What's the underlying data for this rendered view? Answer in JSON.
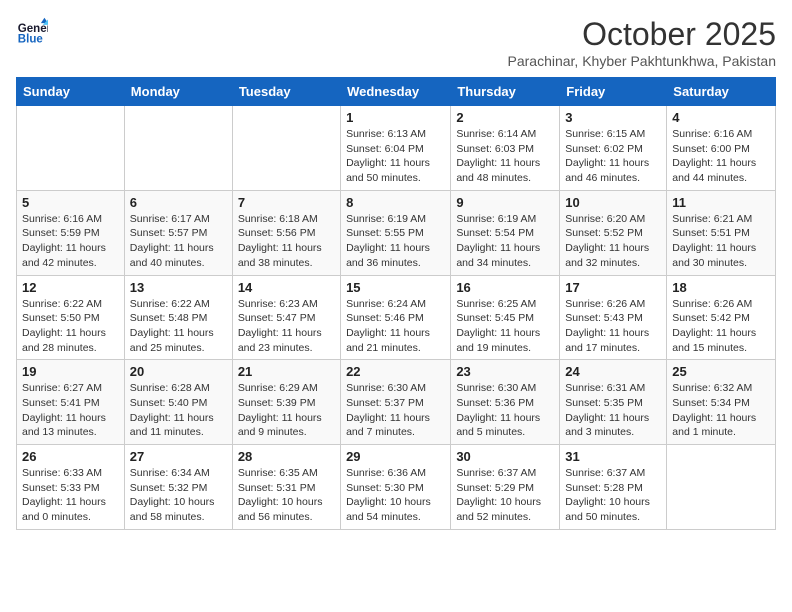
{
  "logo": {
    "line1": "General",
    "line2": "Blue"
  },
  "title": "October 2025",
  "location": "Parachinar, Khyber Pakhtunkhwa, Pakistan",
  "weekdays": [
    "Sunday",
    "Monday",
    "Tuesday",
    "Wednesday",
    "Thursday",
    "Friday",
    "Saturday"
  ],
  "weeks": [
    [
      {
        "day": "",
        "info": ""
      },
      {
        "day": "",
        "info": ""
      },
      {
        "day": "",
        "info": ""
      },
      {
        "day": "1",
        "info": "Sunrise: 6:13 AM\nSunset: 6:04 PM\nDaylight: 11 hours\nand 50 minutes."
      },
      {
        "day": "2",
        "info": "Sunrise: 6:14 AM\nSunset: 6:03 PM\nDaylight: 11 hours\nand 48 minutes."
      },
      {
        "day": "3",
        "info": "Sunrise: 6:15 AM\nSunset: 6:02 PM\nDaylight: 11 hours\nand 46 minutes."
      },
      {
        "day": "4",
        "info": "Sunrise: 6:16 AM\nSunset: 6:00 PM\nDaylight: 11 hours\nand 44 minutes."
      }
    ],
    [
      {
        "day": "5",
        "info": "Sunrise: 6:16 AM\nSunset: 5:59 PM\nDaylight: 11 hours\nand 42 minutes."
      },
      {
        "day": "6",
        "info": "Sunrise: 6:17 AM\nSunset: 5:57 PM\nDaylight: 11 hours\nand 40 minutes."
      },
      {
        "day": "7",
        "info": "Sunrise: 6:18 AM\nSunset: 5:56 PM\nDaylight: 11 hours\nand 38 minutes."
      },
      {
        "day": "8",
        "info": "Sunrise: 6:19 AM\nSunset: 5:55 PM\nDaylight: 11 hours\nand 36 minutes."
      },
      {
        "day": "9",
        "info": "Sunrise: 6:19 AM\nSunset: 5:54 PM\nDaylight: 11 hours\nand 34 minutes."
      },
      {
        "day": "10",
        "info": "Sunrise: 6:20 AM\nSunset: 5:52 PM\nDaylight: 11 hours\nand 32 minutes."
      },
      {
        "day": "11",
        "info": "Sunrise: 6:21 AM\nSunset: 5:51 PM\nDaylight: 11 hours\nand 30 minutes."
      }
    ],
    [
      {
        "day": "12",
        "info": "Sunrise: 6:22 AM\nSunset: 5:50 PM\nDaylight: 11 hours\nand 28 minutes."
      },
      {
        "day": "13",
        "info": "Sunrise: 6:22 AM\nSunset: 5:48 PM\nDaylight: 11 hours\nand 25 minutes."
      },
      {
        "day": "14",
        "info": "Sunrise: 6:23 AM\nSunset: 5:47 PM\nDaylight: 11 hours\nand 23 minutes."
      },
      {
        "day": "15",
        "info": "Sunrise: 6:24 AM\nSunset: 5:46 PM\nDaylight: 11 hours\nand 21 minutes."
      },
      {
        "day": "16",
        "info": "Sunrise: 6:25 AM\nSunset: 5:45 PM\nDaylight: 11 hours\nand 19 minutes."
      },
      {
        "day": "17",
        "info": "Sunrise: 6:26 AM\nSunset: 5:43 PM\nDaylight: 11 hours\nand 17 minutes."
      },
      {
        "day": "18",
        "info": "Sunrise: 6:26 AM\nSunset: 5:42 PM\nDaylight: 11 hours\nand 15 minutes."
      }
    ],
    [
      {
        "day": "19",
        "info": "Sunrise: 6:27 AM\nSunset: 5:41 PM\nDaylight: 11 hours\nand 13 minutes."
      },
      {
        "day": "20",
        "info": "Sunrise: 6:28 AM\nSunset: 5:40 PM\nDaylight: 11 hours\nand 11 minutes."
      },
      {
        "day": "21",
        "info": "Sunrise: 6:29 AM\nSunset: 5:39 PM\nDaylight: 11 hours\nand 9 minutes."
      },
      {
        "day": "22",
        "info": "Sunrise: 6:30 AM\nSunset: 5:37 PM\nDaylight: 11 hours\nand 7 minutes."
      },
      {
        "day": "23",
        "info": "Sunrise: 6:30 AM\nSunset: 5:36 PM\nDaylight: 11 hours\nand 5 minutes."
      },
      {
        "day": "24",
        "info": "Sunrise: 6:31 AM\nSunset: 5:35 PM\nDaylight: 11 hours\nand 3 minutes."
      },
      {
        "day": "25",
        "info": "Sunrise: 6:32 AM\nSunset: 5:34 PM\nDaylight: 11 hours\nand 1 minute."
      }
    ],
    [
      {
        "day": "26",
        "info": "Sunrise: 6:33 AM\nSunset: 5:33 PM\nDaylight: 11 hours\nand 0 minutes."
      },
      {
        "day": "27",
        "info": "Sunrise: 6:34 AM\nSunset: 5:32 PM\nDaylight: 10 hours\nand 58 minutes."
      },
      {
        "day": "28",
        "info": "Sunrise: 6:35 AM\nSunset: 5:31 PM\nDaylight: 10 hours\nand 56 minutes."
      },
      {
        "day": "29",
        "info": "Sunrise: 6:36 AM\nSunset: 5:30 PM\nDaylight: 10 hours\nand 54 minutes."
      },
      {
        "day": "30",
        "info": "Sunrise: 6:37 AM\nSunset: 5:29 PM\nDaylight: 10 hours\nand 52 minutes."
      },
      {
        "day": "31",
        "info": "Sunrise: 6:37 AM\nSunset: 5:28 PM\nDaylight: 10 hours\nand 50 minutes."
      },
      {
        "day": "",
        "info": ""
      }
    ]
  ]
}
